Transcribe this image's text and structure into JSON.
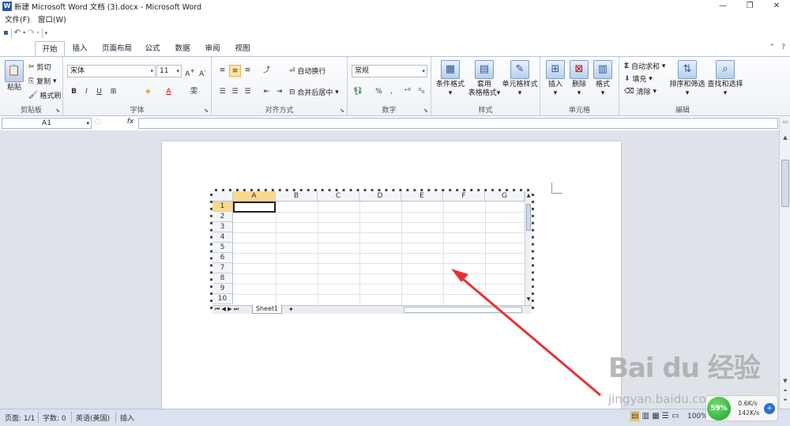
{
  "window": {
    "title": "新建 Microsoft Word 文档 (3).docx - Microsoft Word",
    "app_icon": "W",
    "controls": [
      "—",
      "❐",
      "✕"
    ]
  },
  "menubar": [
    "文件(F)",
    "窗口(W)"
  ],
  "tabs": [
    "开始",
    "插入",
    "页面布局",
    "公式",
    "数据",
    "审阅",
    "视图"
  ],
  "ribbon": {
    "clipboard": {
      "label": "剪贴板",
      "paste": "粘贴",
      "cut": "剪切",
      "copy": "复制",
      "format_painter": "格式刷"
    },
    "font": {
      "label": "字体",
      "font_name": "宋体",
      "font_size": "11"
    },
    "alignment": {
      "label": "对齐方式",
      "wrap_text": "自动换行",
      "merge_center": "合并后居中"
    },
    "number": {
      "label": "数字",
      "format": "常规"
    },
    "styles": {
      "label": "样式",
      "conditional": "条件格式",
      "table_line1": "套用",
      "table_line2": "表格格式",
      "cell_styles": "单元格样式"
    },
    "cells": {
      "label": "单元格",
      "insert": "插入",
      "delete": "删除",
      "format": "格式"
    },
    "editing": {
      "label": "编辑",
      "autosum": "自动求和",
      "fill": "填充",
      "clear": "清除",
      "sort_filter": "排序和筛选",
      "find_select": "查找和选择"
    }
  },
  "formula_bar": {
    "name_box": "A1",
    "fx": "fx"
  },
  "spreadsheet": {
    "columns": [
      "A",
      "B",
      "C",
      "D",
      "E",
      "F",
      "G"
    ],
    "rows": [
      "1",
      "2",
      "3",
      "4",
      "5",
      "6",
      "7",
      "8",
      "9",
      "10"
    ],
    "active_cell": "A1",
    "sheet_tab": "Sheet1"
  },
  "statusbar": {
    "page": "页面: 1/1",
    "words": "字数: 0",
    "language": "英语(美国)",
    "mode": "插入",
    "zoom": "100%"
  },
  "net_widget": {
    "percent": "59%",
    "up": "0.6K/s",
    "down": "142K/s"
  },
  "watermark": {
    "logo": "Bai du 经验",
    "url": "jingyan.baidu.com"
  }
}
